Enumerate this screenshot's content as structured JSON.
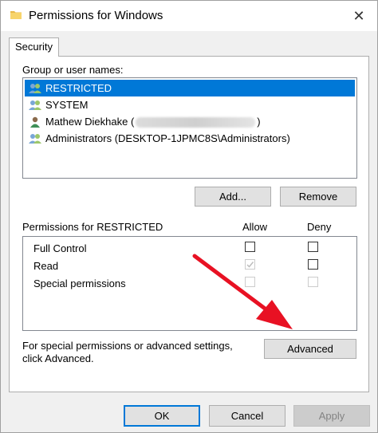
{
  "window": {
    "title": "Permissions for Windows",
    "close_glyph": "✕"
  },
  "tab": {
    "label": "Security"
  },
  "group_section": {
    "label": "Group or user names:",
    "items": [
      {
        "name": "RESTRICTED",
        "selected": true,
        "icon": "users-group-icon"
      },
      {
        "name": "SYSTEM",
        "selected": false,
        "icon": "users-group-icon"
      },
      {
        "name_prefix": "Mathew Diekhake (",
        "name_suffix": ")",
        "selected": false,
        "icon": "user-icon"
      },
      {
        "name": "Administrators (DESKTOP-1JPMC8S\\Administrators)",
        "selected": false,
        "icon": "users-group-icon"
      }
    ],
    "add_button": "Add...",
    "remove_button": "Remove"
  },
  "permissions_section": {
    "label": "Permissions for RESTRICTED",
    "allow_header": "Allow",
    "deny_header": "Deny",
    "rows": [
      {
        "name": "Full Control",
        "allow": "unchecked",
        "deny": "unchecked"
      },
      {
        "name": "Read",
        "allow": "checked-disabled",
        "deny": "unchecked"
      },
      {
        "name": "Special permissions",
        "allow": "disabled",
        "deny": "disabled"
      }
    ]
  },
  "advanced_section": {
    "text_line1": "For special permissions or advanced settings,",
    "text_line2": "click Advanced.",
    "advanced_button": "Advanced"
  },
  "footer": {
    "ok_button": "OK",
    "cancel_button": "Cancel",
    "apply_button": "Apply"
  },
  "colors": {
    "selection": "#0078d7",
    "annotation_arrow": "#e81123"
  }
}
